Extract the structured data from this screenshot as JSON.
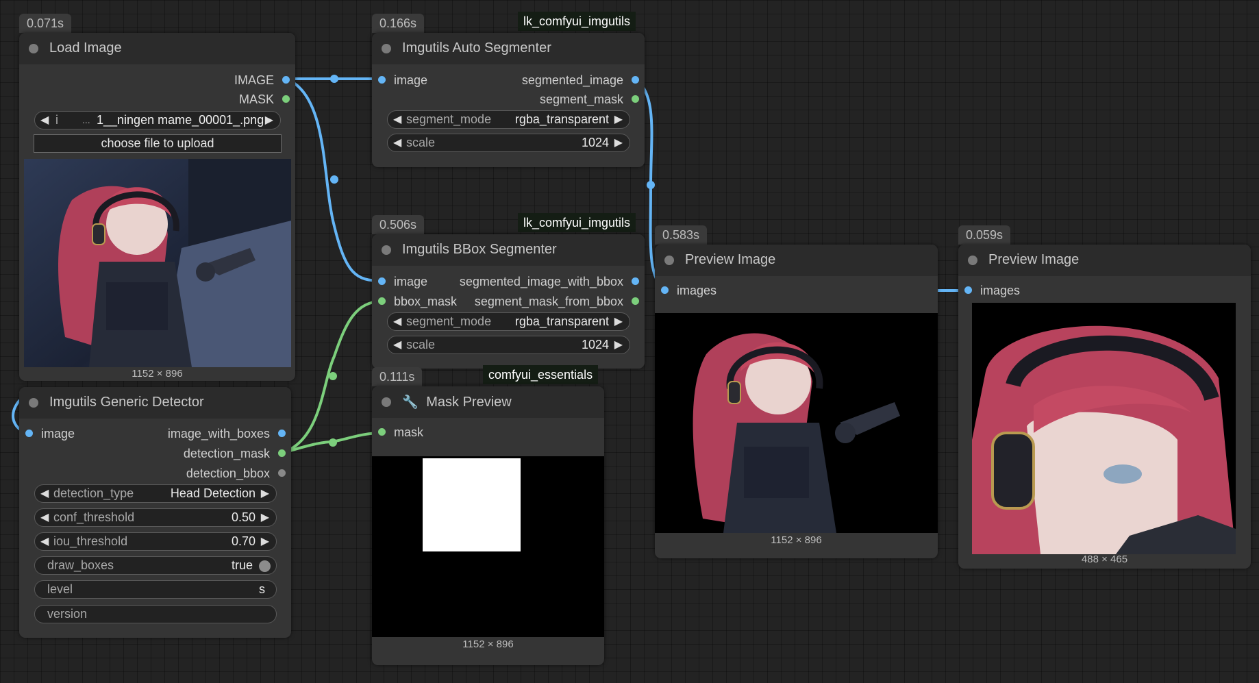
{
  "colors": {
    "canvas": "#232323",
    "node_body": "#353535",
    "node_title": "#2b2b2b",
    "image_link": "#64b5f6",
    "mask_link": "#7ccf7c"
  },
  "nodes": {
    "load_image": {
      "time": "0.071s",
      "title": "Load Image",
      "outputs": [
        "IMAGE",
        "MASK"
      ],
      "image_prefix": "i",
      "image_ellipsis": "...",
      "image_value": "1__ningen mame_00001_.png",
      "upload_label": "choose file to upload",
      "dims": "1152 × 896"
    },
    "auto_segmenter": {
      "time": "0.166s",
      "pack": "lk_comfyui_imgutils",
      "title": "Imgutils Auto Segmenter",
      "inputs": [
        "image"
      ],
      "outputs": [
        "segmented_image",
        "segment_mask"
      ],
      "segment_mode_label": "segment_mode",
      "segment_mode_value": "rgba_transparent",
      "scale_label": "scale",
      "scale_value": "1024"
    },
    "bbox_segmenter": {
      "time": "0.506s",
      "pack": "lk_comfyui_imgutils",
      "title": "Imgutils BBox Segmenter",
      "inputs": [
        "image",
        "bbox_mask"
      ],
      "outputs": [
        "segmented_image_with_bbox",
        "segment_mask_from_bbox"
      ],
      "segment_mode_label": "segment_mode",
      "segment_mode_value": "rgba_transparent",
      "scale_label": "scale",
      "scale_value": "1024"
    },
    "generic_detector": {
      "title": "Imgutils Generic Detector",
      "inputs": [
        "image"
      ],
      "outputs": [
        "image_with_boxes",
        "detection_mask",
        "detection_bbox"
      ],
      "detection_type_label": "detection_type",
      "detection_type_value": "Head Detection",
      "conf_label": "conf_threshold",
      "conf_value": "0.50",
      "iou_label": "iou_threshold",
      "iou_value": "0.70",
      "draw_boxes_label": "draw_boxes",
      "draw_boxes_value": "true",
      "level_label": "level",
      "level_value": "s",
      "version_label": "version"
    },
    "mask_preview": {
      "time": "0.111s",
      "pack": "comfyui_essentials",
      "title": "Mask Preview",
      "inputs": [
        "mask"
      ],
      "dims": "1152 × 896"
    },
    "preview_1": {
      "time": "0.583s",
      "title": "Preview Image",
      "inputs": [
        "images"
      ],
      "dims": "1152 × 896"
    },
    "preview_2": {
      "time": "0.059s",
      "title": "Preview Image",
      "inputs": [
        "images"
      ],
      "dims": "488 × 465"
    }
  }
}
